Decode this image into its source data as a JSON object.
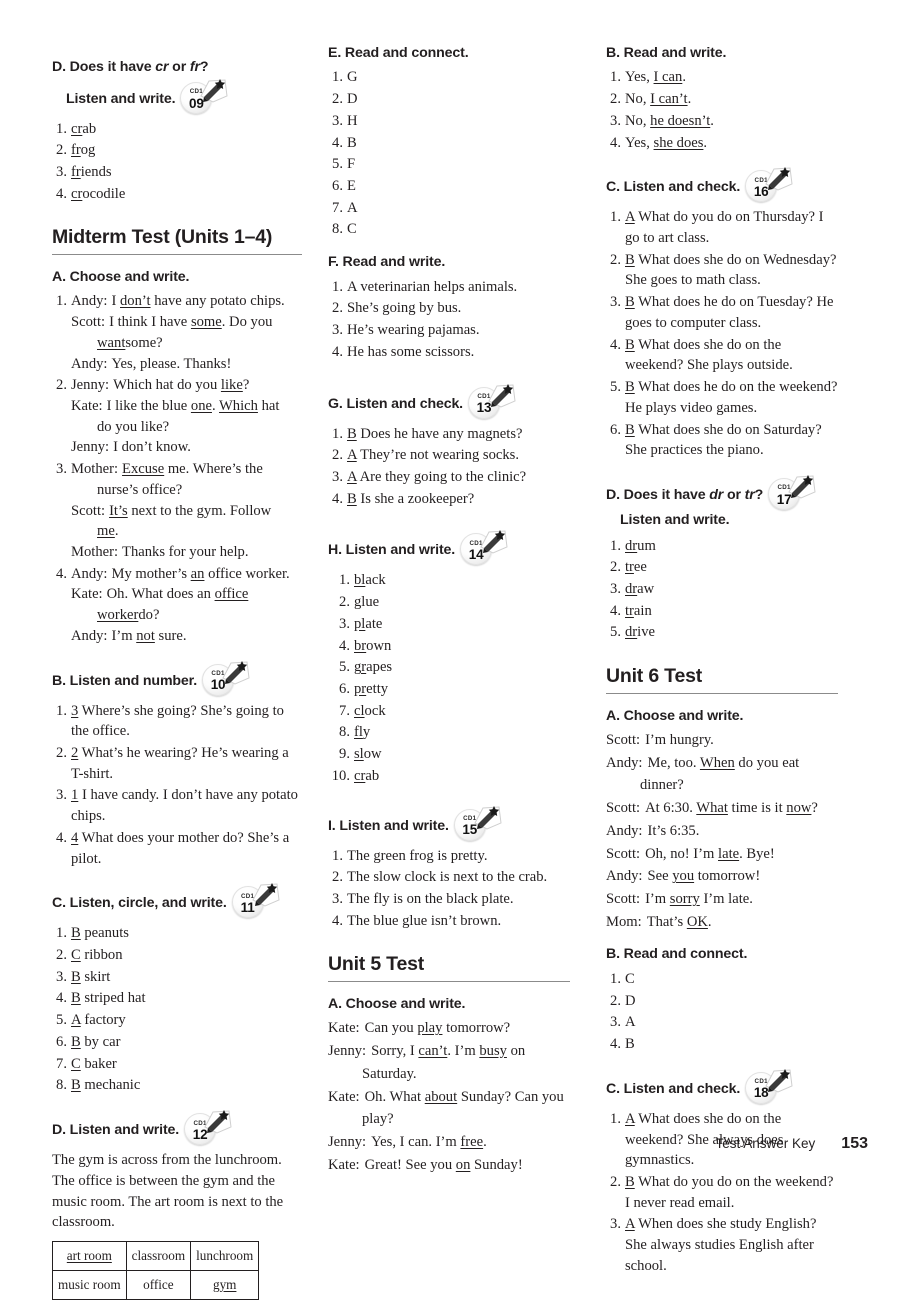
{
  "footer": {
    "label": "Test Answer Key",
    "page": "153"
  },
  "col1": {
    "sectionD_top": {
      "heading_line1_a": "D. Does it have ",
      "heading_line1_cr": "cr",
      "heading_line1_b": " or ",
      "heading_line1_fr": "fr",
      "heading_line1_c": "?",
      "heading_line2": "Listen and write.",
      "cd": {
        "label": "CD1",
        "track": "09"
      },
      "items": [
        {
          "num": "1.",
          "under": "cr",
          "rest": "ab"
        },
        {
          "num": "2.",
          "under": "fr",
          "rest": "og"
        },
        {
          "num": "3.",
          "under": "fr",
          "rest": "iends"
        },
        {
          "num": "4.",
          "under": "cr",
          "rest": "ocodile"
        }
      ]
    },
    "midterm_title": "Midterm Test (Units 1–4)",
    "sectionA": {
      "heading": "A. Choose and write.",
      "items": [
        {
          "num": "1.",
          "lines": [
            {
              "speaker": "Andy:",
              "pre": "I ",
              "under": "don’t",
              "post": " have any potato chips."
            },
            {
              "speaker": "Scott:",
              "pre": "I think I have ",
              "under": "some",
              "post": ". Do you"
            },
            {
              "cont": true,
              "under": "want",
              "post": " some?"
            },
            {
              "speaker": "Andy:",
              "pre": "Yes, please. Thanks!"
            }
          ]
        },
        {
          "num": "2.",
          "lines": [
            {
              "speaker": "Jenny:",
              "pre": "Which hat do you ",
              "under": "like",
              "post": "?"
            },
            {
              "speaker": "Kate:",
              "pre": "I like the blue ",
              "under": "one",
              "post": ". ",
              "under2": "Which",
              "post2": " hat"
            },
            {
              "cont": true,
              "pre": "do you like?"
            },
            {
              "speaker": "Jenny:",
              "pre": "I don’t know."
            }
          ]
        },
        {
          "num": "3.",
          "lines": [
            {
              "speaker": "Mother:",
              "under": "Excuse",
              "post": " me. Where’s the"
            },
            {
              "cont": true,
              "pre": "nurse’s office?"
            },
            {
              "speaker": "Scott:",
              "under": "It’s",
              "post": " next to the gym. Follow"
            },
            {
              "cont": true,
              "under": "me",
              "post": "."
            },
            {
              "speaker": "Mother:",
              "pre": "Thanks for your help."
            }
          ]
        },
        {
          "num": "4.",
          "lines": [
            {
              "speaker": "Andy:",
              "pre": "My mother’s ",
              "under": "an",
              "post": " office worker."
            },
            {
              "speaker": "Kate:",
              "pre": "Oh. What does an ",
              "under": "office "
            },
            {
              "cont": true,
              "under": "worker",
              "post": " do?"
            },
            {
              "speaker": "Andy:",
              "pre": "I’m ",
              "under": "not",
              "post": " sure."
            }
          ]
        }
      ]
    },
    "sectionB": {
      "heading": "B. Listen and number.",
      "cd": {
        "label": "CD1",
        "track": "10"
      },
      "items": [
        {
          "num": "1.",
          "under": "3",
          "text": " Where’s she going? She’s going to the office."
        },
        {
          "num": "2.",
          "under": "2",
          "text": " What’s he wearing? He’s wearing a T-shirt."
        },
        {
          "num": "3.",
          "under": "1",
          "text": " I have candy. I don’t have any potato chips."
        },
        {
          "num": "4.",
          "under": "4",
          "text": " What does your mother do? She’s a pilot."
        }
      ]
    },
    "sectionC": {
      "heading": "C. Listen, circle, and write.",
      "cd": {
        "label": "CD1",
        "track": "11"
      },
      "items": [
        {
          "num": "1.",
          "under": "B",
          "text": " peanuts"
        },
        {
          "num": "2.",
          "under": "C",
          "text": " ribbon"
        },
        {
          "num": "3.",
          "under": "B",
          "text": " skirt"
        },
        {
          "num": "4.",
          "under": "B",
          "text": " striped hat"
        },
        {
          "num": "5.",
          "under": "A",
          "text": " factory"
        },
        {
          "num": "6.",
          "under": "B",
          "text": " by car"
        },
        {
          "num": "7.",
          "under": "C",
          "text": " baker"
        },
        {
          "num": "8.",
          "under": "B",
          "text": " mechanic"
        }
      ]
    },
    "sectionD_bottom": {
      "heading": "D. Listen and write.",
      "cd": {
        "label": "CD1",
        "track": "12"
      },
      "paragraph": "The gym is across from the lunchroom. The office is between the gym and the music room. The art room is next to the classroom.",
      "table": [
        [
          {
            "text": "art room",
            "underline": true
          },
          {
            "text": "classroom",
            "underline": false
          },
          {
            "text": "lunchroom",
            "underline": false
          }
        ],
        [
          {
            "text": "music room",
            "underline": false
          },
          {
            "text": "office",
            "underline": false
          },
          {
            "text": "gym",
            "underline": true
          }
        ]
      ]
    }
  },
  "col2": {
    "sectionE": {
      "heading": "E. Read and connect.",
      "items": [
        {
          "num": "1.",
          "text": "G"
        },
        {
          "num": "2.",
          "text": "D"
        },
        {
          "num": "3.",
          "text": "H"
        },
        {
          "num": "4.",
          "text": "B"
        },
        {
          "num": "5.",
          "text": "F"
        },
        {
          "num": "6.",
          "text": "E"
        },
        {
          "num": "7.",
          "text": "A"
        },
        {
          "num": "8.",
          "text": "C"
        }
      ]
    },
    "sectionF": {
      "heading": "F. Read and write.",
      "items": [
        {
          "num": "1.",
          "text": "A veterinarian helps animals."
        },
        {
          "num": "2.",
          "text": "She’s going by bus."
        },
        {
          "num": "3.",
          "text": "He’s wearing pajamas."
        },
        {
          "num": "4.",
          "text": "He has some scissors."
        }
      ]
    },
    "sectionG": {
      "heading": "G. Listen and check.",
      "cd": {
        "label": "CD1",
        "track": "13"
      },
      "items": [
        {
          "num": "1.",
          "under": "B",
          "text": " Does he have any magnets?"
        },
        {
          "num": "2.",
          "under": "A",
          "text": " They’re not wearing socks."
        },
        {
          "num": "3.",
          "under": "A",
          "text": " Are they going to the clinic?"
        },
        {
          "num": "4.",
          "under": "B",
          "text": " Is she a zookeeper?"
        }
      ]
    },
    "sectionH": {
      "heading": "H. Listen and write.",
      "cd": {
        "label": "CD1",
        "track": "14"
      },
      "items": [
        {
          "num": "1.",
          "under": "bl",
          "rest": "ack"
        },
        {
          "num": "2.",
          "under": "g",
          "rest": "lue"
        },
        {
          "num": "3.",
          "under": "pl",
          "rest": "ate"
        },
        {
          "num": "4.",
          "under": "br",
          "rest": "own"
        },
        {
          "num": "5.",
          "under": "gr",
          "rest": "apes"
        },
        {
          "num": "6.",
          "under": "pr",
          "rest": "etty"
        },
        {
          "num": "7.",
          "under": "cl",
          "rest": "ock"
        },
        {
          "num": "8.",
          "under": "fl",
          "rest": "y"
        },
        {
          "num": "9.",
          "under": "sl",
          "rest": "ow"
        },
        {
          "num": "10.",
          "under": "cr",
          "rest": "ab"
        }
      ]
    },
    "sectionI": {
      "heading": "I. Listen and write.",
      "cd": {
        "label": "CD1",
        "track": "15"
      },
      "items": [
        {
          "num": "1.",
          "text": "The green frog is pretty."
        },
        {
          "num": "2.",
          "text": "The slow clock is next to the crab."
        },
        {
          "num": "3.",
          "text": "The fly is on the black plate."
        },
        {
          "num": "4.",
          "text": "The blue glue isn’t brown."
        }
      ]
    },
    "unit5_title": "Unit 5 Test",
    "u5_sectionA": {
      "heading": "A. Choose and write.",
      "lines": [
        {
          "speaker": "Kate:",
          "pre": "Can you ",
          "under": "play",
          "post": " tomorrow?"
        },
        {
          "speaker": "Jenny:",
          "pre": "Sorry, I ",
          "under": "can’t",
          "post": ". I’m ",
          "under2": "busy",
          "post2": " on"
        },
        {
          "indent": true,
          "pre": "Saturday."
        },
        {
          "speaker": "Kate:",
          "pre": "Oh. What ",
          "under": "about",
          "post": " Sunday? Can you"
        },
        {
          "indent": true,
          "pre": "play?"
        },
        {
          "speaker": "Jenny:",
          "pre": "Yes, I can. I’m ",
          "under": "free",
          "post": "."
        },
        {
          "speaker": "Kate:",
          "pre": "Great! See you ",
          "under": "on",
          "post": " Sunday!"
        }
      ]
    }
  },
  "col3": {
    "u5_sectionB": {
      "heading": "B. Read and write.",
      "items": [
        {
          "num": "1.",
          "pre": "Yes, ",
          "under": "I can",
          "post": "."
        },
        {
          "num": "2.",
          "pre": "No, ",
          "under": "I can’t",
          "post": "."
        },
        {
          "num": "3.",
          "pre": "No, ",
          "under": "he doesn’t",
          "post": "."
        },
        {
          "num": "4.",
          "pre": "Yes, ",
          "under": "she does",
          "post": "."
        }
      ]
    },
    "u5_sectionC": {
      "heading": "C. Listen and check.",
      "cd": {
        "label": "CD1",
        "track": "16"
      },
      "items": [
        {
          "num": "1.",
          "under": "A",
          "text": " What do you do on Thursday? I go to art class."
        },
        {
          "num": "2.",
          "under": "B",
          "text": " What does she do on Wednesday? She goes to math class."
        },
        {
          "num": "3.",
          "under": "B",
          "text": " What does he do on Tuesday? He goes to computer class."
        },
        {
          "num": "4.",
          "under": "B",
          "text": " What does she do on the weekend? She plays outside."
        },
        {
          "num": "5.",
          "under": "B",
          "text": " What does he do on the weekend? He plays video games."
        },
        {
          "num": "6.",
          "under": "B",
          "text": " What does she do on Saturday? She practices the piano."
        }
      ]
    },
    "u5_sectionD": {
      "heading_line1_a": "D. Does it have ",
      "heading_line1_dr": "dr",
      "heading_line1_b": " or ",
      "heading_line1_tr": "tr",
      "heading_line1_c": "?",
      "heading_line2": "Listen and write.",
      "cd": {
        "label": "CD1",
        "track": "17"
      },
      "items": [
        {
          "num": "1.",
          "under": "dr",
          "rest": "um"
        },
        {
          "num": "2.",
          "under": "tr",
          "rest": "ee"
        },
        {
          "num": "3.",
          "under": "dr",
          "rest": "aw"
        },
        {
          "num": "4.",
          "under": "tr",
          "rest": "ain"
        },
        {
          "num": "5.",
          "under": "dr",
          "rest": "ive"
        }
      ]
    },
    "unit6_title": "Unit 6 Test",
    "u6_sectionA": {
      "heading": "A. Choose and write.",
      "lines": [
        {
          "speaker": "Scott:",
          "pre": "I’m hungry."
        },
        {
          "speaker": "Andy:",
          "pre": "Me, too. ",
          "under": "When",
          "post": " do you eat"
        },
        {
          "indent": true,
          "pre": "dinner?"
        },
        {
          "speaker": "Scott:",
          "pre": "At 6:30. ",
          "under": "What",
          "post": " time is it ",
          "under2": "now",
          "post2": "?"
        },
        {
          "speaker": "Andy:",
          "pre": "It’s 6:35."
        },
        {
          "speaker": "Scott:",
          "pre": "Oh, no! I’m ",
          "under": "late",
          "post": ". Bye!"
        },
        {
          "speaker": "Andy:",
          "pre": "See ",
          "under": "you",
          "post": " tomorrow!"
        },
        {
          "speaker": "Scott:",
          "pre": "I’m ",
          "under": "sorry",
          "post": " I’m late."
        },
        {
          "speaker": "Mom:",
          "pre": "That’s ",
          "under": "OK",
          "post": "."
        }
      ]
    },
    "u6_sectionB": {
      "heading": "B. Read and connect.",
      "items": [
        {
          "num": "1.",
          "text": "C"
        },
        {
          "num": "2.",
          "text": "D"
        },
        {
          "num": "3.",
          "text": "A"
        },
        {
          "num": "4.",
          "text": "B"
        }
      ]
    },
    "u6_sectionC": {
      "heading": "C. Listen and check.",
      "cd": {
        "label": "CD1",
        "track": "18"
      },
      "items": [
        {
          "num": "1.",
          "under": "A",
          "text": " What does she do on the weekend? She always does gymnastics."
        },
        {
          "num": "2.",
          "under": "B",
          "text": " What do you do on the weekend? I never read email."
        },
        {
          "num": "3.",
          "under": "A",
          "text": " When does she study English? She always studies English after school."
        }
      ]
    }
  }
}
